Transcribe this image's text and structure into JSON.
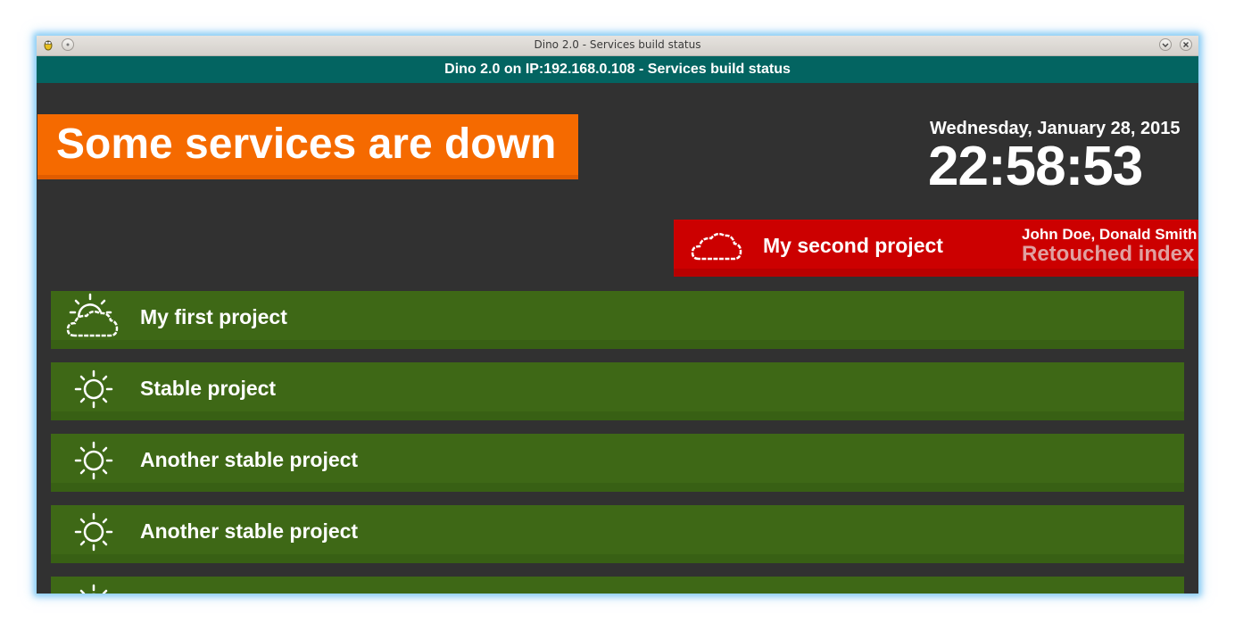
{
  "window": {
    "title": "Dino 2.0 - Services build status",
    "shadow_color": "#8ccff5"
  },
  "header": {
    "text": "Dino 2.0 on IP:192.168.0.108 - Services build status",
    "color": "#036461"
  },
  "status": {
    "text": "Some services are down",
    "color": "#f56a00"
  },
  "clock": {
    "date": "Wednesday, January 28, 2015",
    "time": "22:58:53"
  },
  "failing": {
    "name": "My second project",
    "authors": "John Doe, Donald Smith",
    "commit_message": "Retouched index",
    "icon": "cloud-icon",
    "color": "#cc0000"
  },
  "projects": [
    {
      "name": "My first project",
      "icon": "partly-cloudy-icon"
    },
    {
      "name": "Stable project",
      "icon": "sun-icon"
    },
    {
      "name": "Another stable project",
      "icon": "sun-icon"
    },
    {
      "name": "Another stable project",
      "icon": "sun-icon"
    },
    {
      "name": "",
      "icon": "sun-icon"
    }
  ],
  "colors": {
    "background": "#313131",
    "success": "#3e6816"
  }
}
